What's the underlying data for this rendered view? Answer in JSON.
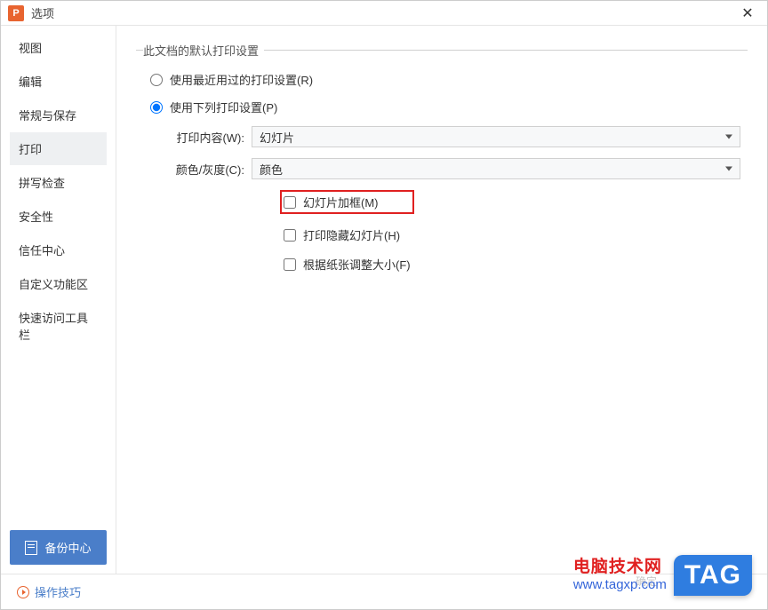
{
  "titlebar": {
    "title": "选项"
  },
  "sidebar": {
    "items": [
      {
        "label": "视图",
        "selected": false
      },
      {
        "label": "编辑",
        "selected": false
      },
      {
        "label": "常规与保存",
        "selected": false
      },
      {
        "label": "打印",
        "selected": true
      },
      {
        "label": "拼写检查",
        "selected": false
      },
      {
        "label": "安全性",
        "selected": false
      },
      {
        "label": "信任中心",
        "selected": false
      },
      {
        "label": "自定义功能区",
        "selected": false
      },
      {
        "label": "快速访问工具栏",
        "selected": false
      }
    ],
    "backup_label": "备份中心"
  },
  "content": {
    "group_title": "此文档的默认打印设置",
    "radio_recent": "使用最近用过的打印设置(R)",
    "radio_below": "使用下列打印设置(P)",
    "radio_selected": "below",
    "print_content_label": "打印内容(W):",
    "print_content_value": "幻灯片",
    "color_label": "颜色/灰度(C):",
    "color_value": "颜色",
    "check_frame": "幻灯片加框(M)",
    "check_hidden": "打印隐藏幻灯片(H)",
    "check_scale": "根据纸张调整大小(F)"
  },
  "footer": {
    "tips_label": "操作技巧",
    "ok_label": "确定"
  },
  "watermark": {
    "line1": "电脑技术网",
    "line2": "www.tagxp.com",
    "tag": "TAG"
  }
}
